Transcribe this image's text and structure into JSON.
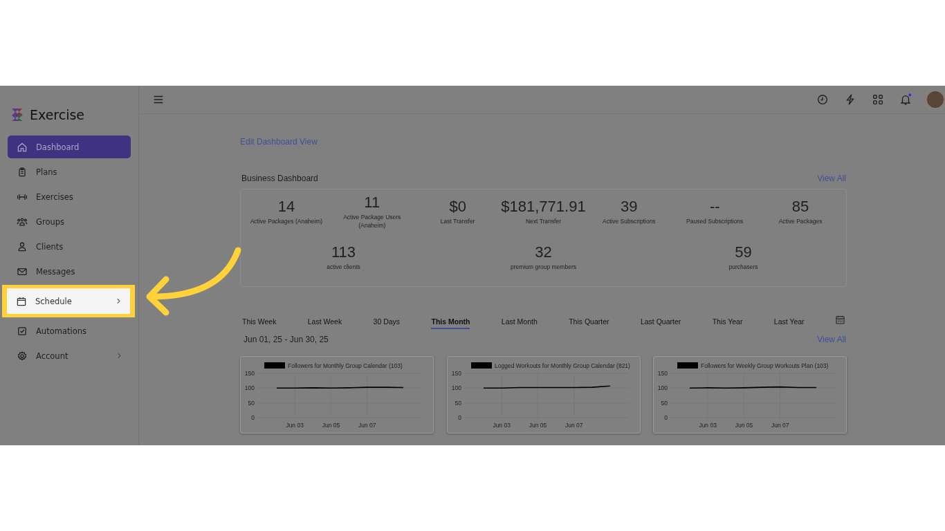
{
  "brand": {
    "name": "Exercise"
  },
  "sidebar": {
    "items": [
      {
        "label": "Dashboard",
        "selected": true,
        "highlighted": false,
        "has_children": false
      },
      {
        "label": "Plans",
        "selected": false,
        "highlighted": false,
        "has_children": false
      },
      {
        "label": "Exercises",
        "selected": false,
        "highlighted": false,
        "has_children": false
      },
      {
        "label": "Groups",
        "selected": false,
        "highlighted": false,
        "has_children": false
      },
      {
        "label": "Clients",
        "selected": false,
        "highlighted": false,
        "has_children": false
      },
      {
        "label": "Messages",
        "selected": false,
        "highlighted": false,
        "has_children": false
      },
      {
        "label": "Schedule",
        "selected": false,
        "highlighted": true,
        "has_children": true
      },
      {
        "label": "Automations",
        "selected": false,
        "highlighted": false,
        "has_children": false
      },
      {
        "label": "Account",
        "selected": false,
        "highlighted": false,
        "has_children": true
      }
    ]
  },
  "header": {
    "notification_unread": true
  },
  "edit_link": "Edit Dashboard View",
  "business": {
    "title": "Business Dashboard",
    "view_all": "View All",
    "row_1": [
      {
        "value": "14",
        "label": "Active Packages (Anaheim)"
      },
      {
        "value": "11",
        "label": "Active Package Users (Anaheim)"
      },
      {
        "value": "$0",
        "label": "Last Transfer"
      },
      {
        "value": "$181,771.91",
        "label": "Next Transfer"
      },
      {
        "value": "39",
        "label": "Active Subscriptions"
      },
      {
        "value": "--",
        "label": "Paused Subscriptions"
      },
      {
        "value": "85",
        "label": "Active Packages"
      }
    ],
    "row_2": [
      {
        "value": "113",
        "label": "active clients"
      },
      {
        "value": "32",
        "label": "premium group members"
      },
      {
        "value": "59",
        "label": "purchasers"
      }
    ]
  },
  "periods": [
    {
      "label": "This Week",
      "selected": false
    },
    {
      "label": "Last Week",
      "selected": false
    },
    {
      "label": "30 Days",
      "selected": false
    },
    {
      "label": "This Month",
      "selected": true
    },
    {
      "label": "Last Month",
      "selected": false
    },
    {
      "label": "This Quarter",
      "selected": false
    },
    {
      "label": "Last Quarter",
      "selected": false
    },
    {
      "label": "This Year",
      "selected": false
    },
    {
      "label": "Last Year",
      "selected": false
    }
  ],
  "date_range": "Jun 01, 25 - Jun 30, 25",
  "charts_view_all": "View All",
  "charts": [
    {
      "chart_data": {
        "type": "line",
        "grid": true,
        "categories": [
          null,
          "Jun 03",
          null,
          "Jun 05",
          null,
          "Jun 07",
          null,
          null
        ],
        "ylim": [
          0,
          150
        ],
        "yticks": [
          0,
          50,
          100,
          150
        ],
        "series": [
          {
            "name": "Followers for Monthly Group Calendar (103)",
            "color": "#000000",
            "values": [
              100,
              100,
              101,
              100,
              101,
              103,
              103,
              102
            ]
          }
        ]
      }
    },
    {
      "chart_data": {
        "type": "line",
        "grid": true,
        "categories": [
          null,
          "Jun 03",
          null,
          "Jun 05",
          null,
          "Jun 07",
          null,
          null
        ],
        "ylim": [
          0,
          150
        ],
        "yticks": [
          0,
          50,
          100,
          150
        ],
        "series": [
          {
            "name": "Logged Workouts for Monthly Group Calendar (821)",
            "color": "#000000",
            "values": [
              100,
              100,
              102,
              102,
              102,
              102,
              103,
              107
            ]
          }
        ]
      }
    },
    {
      "chart_data": {
        "type": "line",
        "grid": true,
        "categories": [
          null,
          "Jun 03",
          null,
          "Jun 05",
          null,
          "Jun 07",
          null,
          null
        ],
        "ylim": [
          0,
          150
        ],
        "yticks": [
          0,
          50,
          100,
          150
        ],
        "series": [
          {
            "name": "Followers for Weekly Group Workouts Plan (103)",
            "color": "#000000",
            "values": [
              100,
              101,
              100,
              101,
              103,
              104,
              102,
              102
            ]
          }
        ]
      }
    }
  ]
}
